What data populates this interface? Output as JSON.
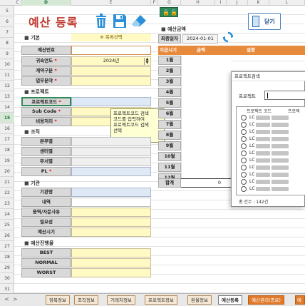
{
  "columns": {
    "letters": [
      "C",
      "D",
      "E",
      "F",
      "G",
      "H",
      "I",
      "J",
      "K",
      "L"
    ],
    "selected": "D"
  },
  "rows": {
    "numbers": [
      5,
      6,
      7,
      8,
      9,
      10,
      11,
      12,
      13,
      14,
      15,
      16,
      17,
      18,
      19,
      20,
      21,
      22,
      23,
      24,
      25,
      26,
      27,
      28,
      29,
      30,
      31
    ],
    "selected": 15
  },
  "title": "예산 등록",
  "toolbar": {
    "delete_icon": "trash-icon",
    "save_icon": "floppy-save-icon",
    "eraser_icon": "eraser-icon",
    "lock_icons": [
      "lock-icon",
      "unlock-icon"
    ],
    "close_label": "닫기"
  },
  "basic": {
    "section": "기본",
    "project_select_label": "※ 목록선택",
    "fields": [
      {
        "label": "예산번호",
        "value": "",
        "required": false
      },
      {
        "label": "귀속연도",
        "value": "2024년",
        "required": true
      },
      {
        "label": "계약구분",
        "value": "",
        "required": true
      },
      {
        "label": "업무분야",
        "value": "",
        "required": true
      }
    ]
  },
  "project": {
    "section": "프로젝트",
    "fields": [
      {
        "label": "프로젝트코드",
        "required": true
      },
      {
        "label": "Sub Code",
        "required": true
      },
      {
        "label": "비용처리",
        "required": true
      }
    ],
    "tooltip": [
      "프로젝트코드 검색",
      "코드를 입력하여",
      "프로젝트코드 검색",
      "선택"
    ]
  },
  "org": {
    "section": "조직",
    "fields": [
      {
        "label": "본부별",
        "required": false
      },
      {
        "label": "센터별",
        "required": false
      },
      {
        "label": "부서별",
        "required": false
      },
      {
        "label": "PL",
        "required": true
      }
    ]
  },
  "period": {
    "section": "기관",
    "fields": [
      "기관명",
      "내역",
      "용역/자문사유",
      "필요성",
      "예산시기"
    ]
  },
  "progress": {
    "section": "예산진행율",
    "fields": [
      "BEST",
      "NORMAL",
      "WORST"
    ]
  },
  "budget": {
    "section": "예산금액",
    "date_label": "최종일자",
    "date_value": "2024-01-01",
    "refresh_icon": "refresh-icon",
    "headers": [
      "지급시기",
      "금액",
      "설명"
    ],
    "months": [
      "1월",
      "2월",
      "3월",
      "4월",
      "5월",
      "6월",
      "7월",
      "8월",
      "9월",
      "10월",
      "11월",
      "12월"
    ],
    "total_label": "합계",
    "total_value": "0"
  },
  "dialog": {
    "title": "프로젝트검색",
    "search_label": "프로젝트",
    "col_code": "프로젝트 코드",
    "col_name": "프로젝",
    "items": [
      "LC",
      "LC",
      "LC",
      "LC",
      "LC",
      "LC",
      "LC",
      "LC",
      "LC",
      "LC",
      "LC",
      "LC"
    ],
    "count_text": "총 건수 : 142건"
  },
  "tabs": {
    "nav": [
      "<",
      ">"
    ],
    "items": [
      "항목정보",
      "조직정보",
      "거래처정보",
      "프로젝트정보",
      "환율정보",
      "예산등록",
      "예산관리(종료)",
      "예"
    ],
    "active": "예산등록"
  }
}
